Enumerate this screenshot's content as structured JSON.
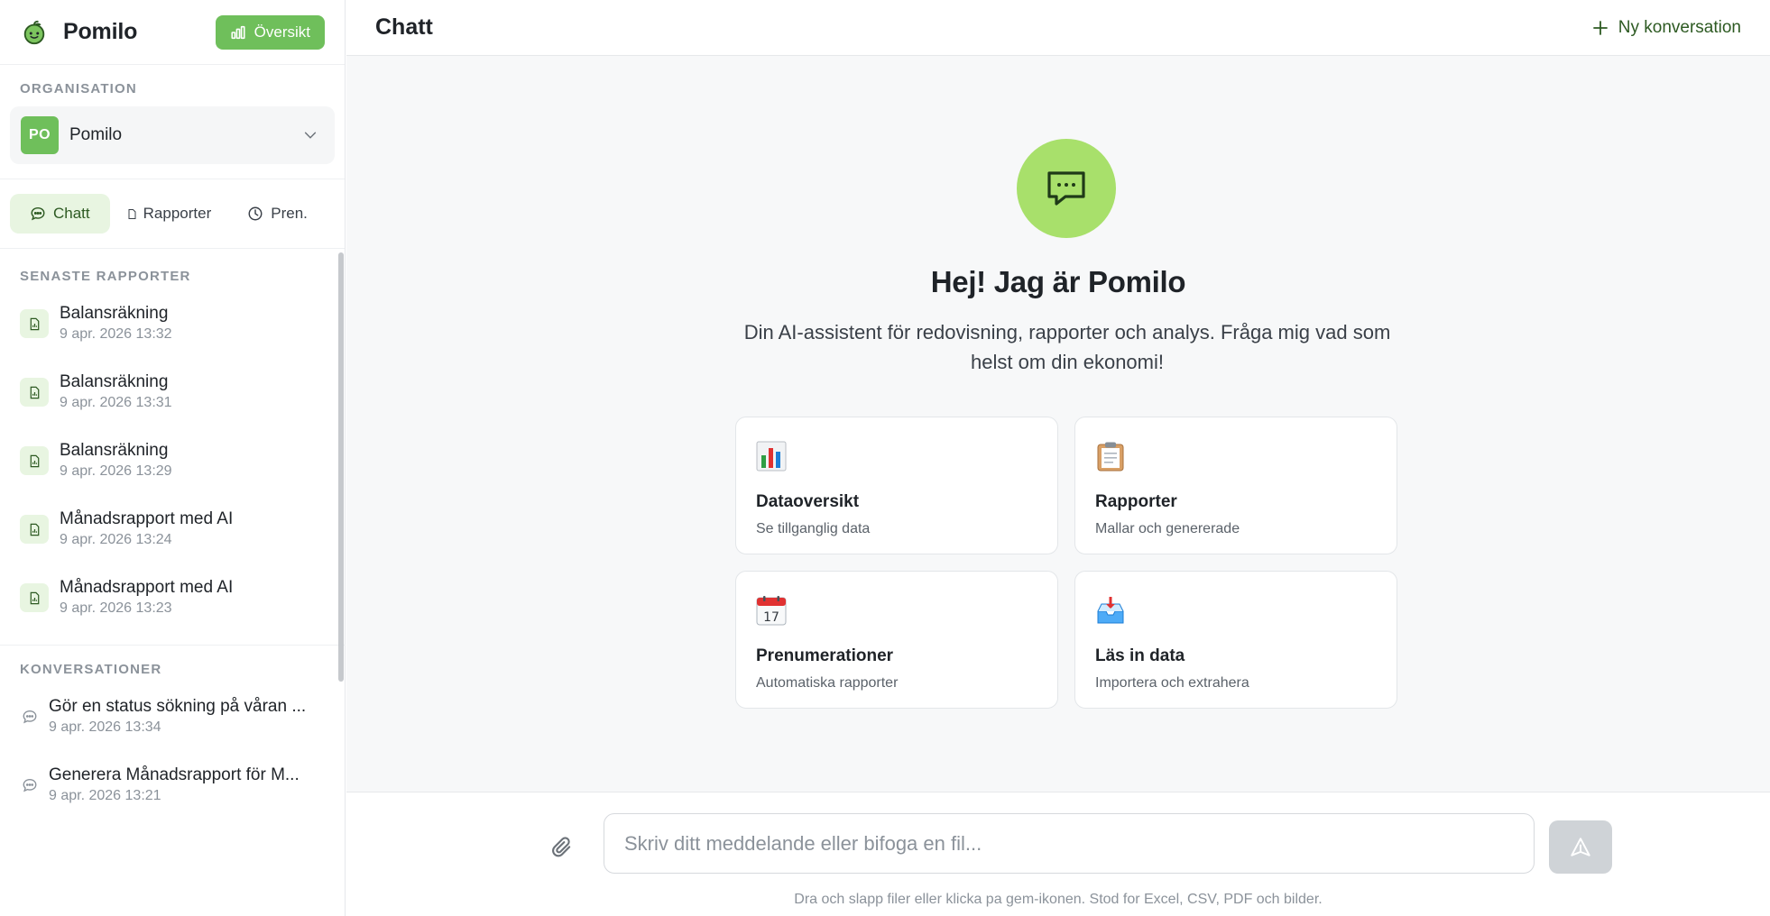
{
  "brand": {
    "name": "Pomilo",
    "overview_label": "Översikt"
  },
  "organisation": {
    "section_label": "ORGANISATION",
    "badge": "PO",
    "name": "Pomilo"
  },
  "nav_tabs": [
    {
      "label": "Chatt",
      "active": true
    },
    {
      "label": "Rapporter",
      "active": false
    },
    {
      "label": "Pren.",
      "active": false
    }
  ],
  "recent_reports": {
    "section_label": "SENASTE RAPPORTER",
    "items": [
      {
        "title": "Balansräkning",
        "date": "9 apr. 2026 13:32"
      },
      {
        "title": "Balansräkning",
        "date": "9 apr. 2026 13:31"
      },
      {
        "title": "Balansräkning",
        "date": "9 apr. 2026 13:29"
      },
      {
        "title": "Månadsrapport med AI",
        "date": "9 apr. 2026 13:24"
      },
      {
        "title": "Månadsrapport med AI",
        "date": "9 apr. 2026 13:23"
      }
    ]
  },
  "conversations": {
    "section_label": "KONVERSATIONER",
    "items": [
      {
        "title": "Gör en status sökning på våran ...",
        "date": "9 apr. 2026 13:34"
      },
      {
        "title": "Generera Månadsrapport för M...",
        "date": "9 apr. 2026 13:21"
      }
    ]
  },
  "header": {
    "title": "Chatt",
    "new_conversation_label": "Ny konversation"
  },
  "hero": {
    "title": "Hej! Jag är Pomilo",
    "subtitle": "Din AI-assistent för redovisning, rapporter och analys. Fråga mig vad som helst om din ekonomi!"
  },
  "cards": [
    {
      "icon": "bar-chart-emoji",
      "title": "Dataoversikt",
      "desc": "Se tillganglig data"
    },
    {
      "icon": "clipboard-emoji",
      "title": "Rapporter",
      "desc": "Mallar och genererade"
    },
    {
      "icon": "calendar-emoji",
      "title": "Prenumerationer",
      "desc": "Automatiska rapporter"
    },
    {
      "icon": "inbox-tray-emoji",
      "title": "Läs in data",
      "desc": "Importera och extrahera"
    }
  ],
  "composer": {
    "placeholder": "Skriv ditt meddelande eller bifoga en fil...",
    "hint": "Dra och slapp filer eller klicka pa gem-ikonen. Stod for Excel, CSV, PDF och bilder."
  },
  "colors": {
    "accent": "#6fbf5b",
    "hero_circle": "#a8e06b",
    "active_tab_bg": "#e8f5e1",
    "dark_green": "#2d5a22"
  }
}
